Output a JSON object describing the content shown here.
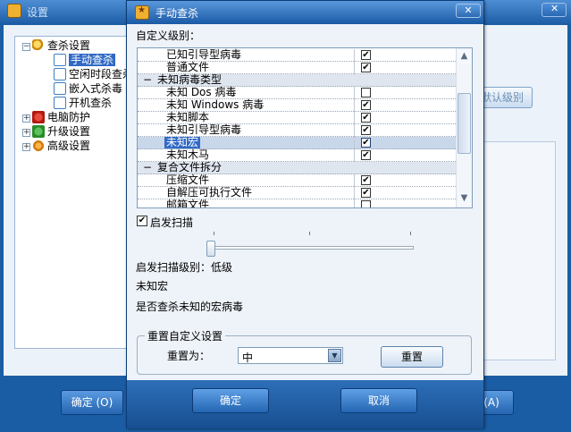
{
  "background_window": {
    "title": "设置",
    "tree": [
      {
        "label": "查杀设置",
        "expander": "−"
      },
      {
        "label": "手动查杀",
        "selected": true
      },
      {
        "label": "空闲时段查杀"
      },
      {
        "label": "嵌入式杀毒"
      },
      {
        "label": "开机查杀"
      },
      {
        "label": "电脑防护",
        "expander": "+"
      },
      {
        "label": "升级设置",
        "expander": "+"
      },
      {
        "label": "高级设置",
        "expander": "+"
      }
    ],
    "default_level_button": "默认级别",
    "ok_button": "确定 (O)",
    "apply_button": "(A)"
  },
  "dialog": {
    "title": "手动查杀",
    "close_icon": "close-icon",
    "custom_level_label": "自定义级别：",
    "list": [
      {
        "name": "已知引导型病毒",
        "checked": true
      },
      {
        "name": "普通文件",
        "checked": true
      },
      {
        "name": "未知病毒类型",
        "category": true,
        "sign": "−"
      },
      {
        "name": "未知 Dos 病毒",
        "checked": false
      },
      {
        "name": "未知 Windows 病毒",
        "checked": true
      },
      {
        "name": "未知脚本",
        "checked": true
      },
      {
        "name": "未知引导型病毒",
        "checked": true
      },
      {
        "name": "未知宏",
        "checked": true,
        "selected": true
      },
      {
        "name": "未知木马",
        "checked": true
      },
      {
        "name": "复合文件拆分",
        "category": true,
        "sign": "−"
      },
      {
        "name": "压缩文件",
        "checked": true
      },
      {
        "name": "自解压可执行文件",
        "checked": true
      },
      {
        "name": "邮箱文件",
        "checked": false
      }
    ],
    "heuristic_label": "启发扫描",
    "heuristic_checked": true,
    "heuristic_level_fraction": 0.0,
    "level_text": "启发扫描级别：低级",
    "desc_title": "未知宏",
    "desc_body": "是否查杀未知的宏病毒",
    "reset_group": {
      "legend": "重置自定义设置",
      "reset_to_label": "重置为：",
      "combo_value": "中",
      "reset_button": "重置"
    },
    "ok_button": "确定",
    "cancel_button": "取消"
  }
}
